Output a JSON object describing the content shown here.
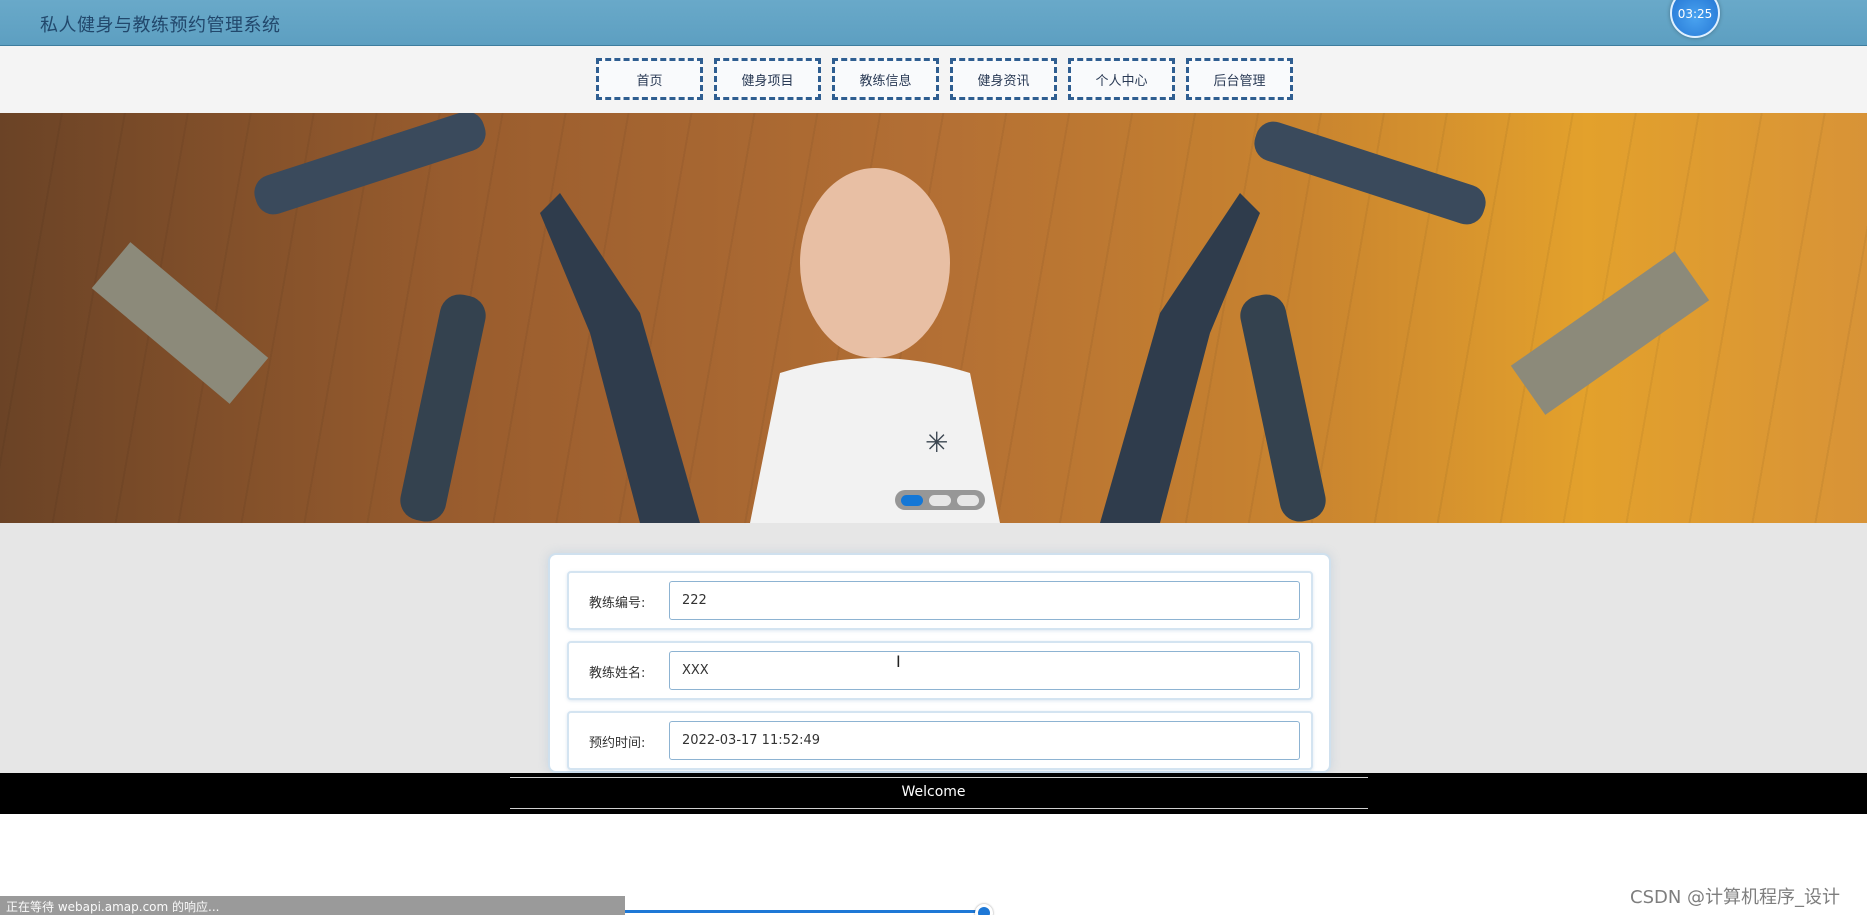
{
  "header": {
    "site_title": "私人健身与教练预约管理系统",
    "timer": "03:25"
  },
  "nav": {
    "items": [
      {
        "label": "首页"
      },
      {
        "label": "健身项目"
      },
      {
        "label": "教练信息"
      },
      {
        "label": "健身资讯"
      },
      {
        "label": "个人中心"
      },
      {
        "label": "后台管理"
      }
    ]
  },
  "banner": {
    "carousel_active_index": 0,
    "carousel_count": 3,
    "loading_icon": "spinner-icon"
  },
  "form": {
    "fields": [
      {
        "label": "教练编号:",
        "value": "222"
      },
      {
        "label": "教练姓名:",
        "value": "XXX"
      },
      {
        "label": "预约时间:",
        "value": "2022-03-17 11:52:49"
      }
    ]
  },
  "footer": {
    "text": "Welcome"
  },
  "status": {
    "text": "正在等待 webapi.amap.com 的响应..."
  },
  "watermark": {
    "text": "CSDN @计算机程序_设计"
  },
  "colors": {
    "header_bg": "#69a9c9",
    "nav_border": "#2f5e91",
    "active_dot": "#1477d6",
    "footer_bg": "#000000"
  }
}
